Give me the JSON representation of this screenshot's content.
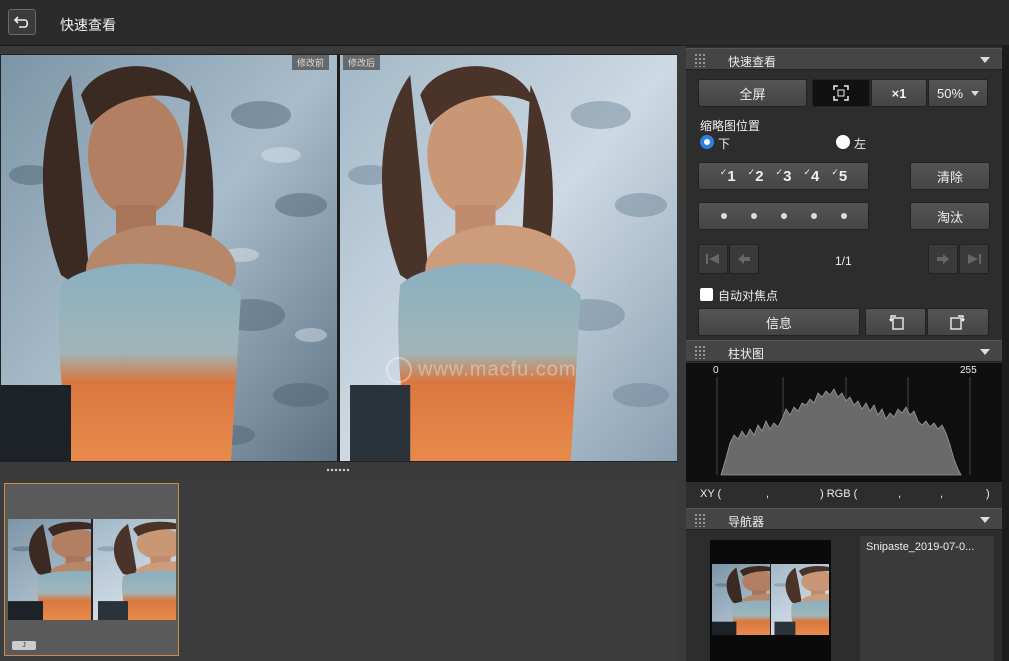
{
  "topbar": {
    "title": "快速查看"
  },
  "preview": {
    "before_tag": "修改前",
    "after_tag": "修改后",
    "watermark": "www.macfu.com"
  },
  "filmstrip": {
    "badge": "J"
  },
  "quickview": {
    "header": "快速查看",
    "fullscreen_label": "全屏",
    "zoom_1x_label": "×1",
    "zoom_select_value": "50%",
    "thumb_position_label": "缩略图位置",
    "radio_bottom_label": "下",
    "radio_left_label": "左",
    "ratings": [
      "1",
      "2",
      "3",
      "4",
      "5"
    ],
    "clear_label": "清除",
    "reject_label": "淘汰",
    "page_counter": "1/1",
    "autofocus_label": "自动对焦点",
    "info_label": "信息"
  },
  "histogram": {
    "header": "柱状图",
    "min_label": "0",
    "max_label": "255",
    "xy_label": "XY (",
    "xy_sep1": ",",
    "xy_close": ") RGB (",
    "rgb_sep1": ",",
    "rgb_sep2": ",",
    "rgb_close": ")"
  },
  "navigator": {
    "header": "导航器",
    "filename": "Snipaste_2019-07-0..."
  },
  "colors": {
    "accent_blue": "#2f7fe0",
    "selection_orange": "#c98a4a"
  }
}
